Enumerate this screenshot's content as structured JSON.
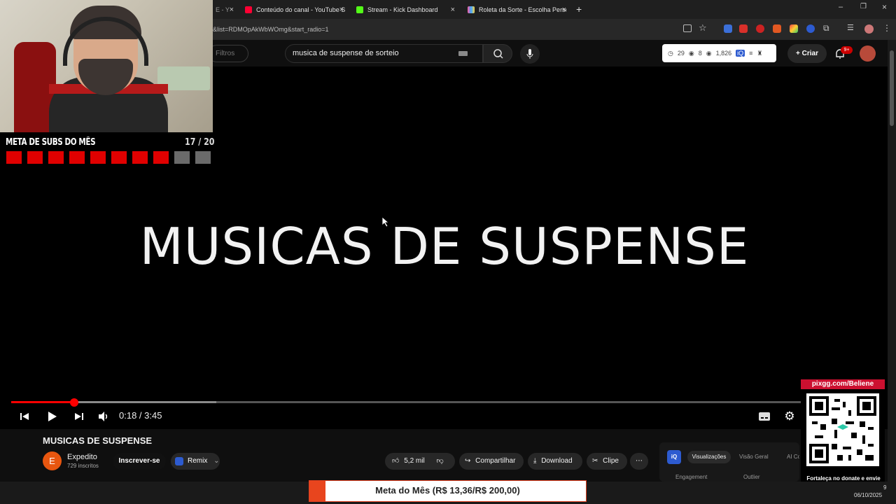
{
  "browser": {
    "tabs": [
      {
        "title": "Conteúdo do canal - YouTube S",
        "color": "#ff0033"
      },
      {
        "title": "Stream - Kick Dashboard",
        "color": "#53fc18"
      },
      {
        "title": "Roleta da Sorte - Escolha Perso",
        "color": "#ff5aa0"
      }
    ],
    "partial_tab_suffix": "E - Y",
    "url_fragment": "&list=RDMOpAkWbWOmg&start_radio=1",
    "new_tab_icon": "plus-icon"
  },
  "youtube": {
    "filters_label": "Filtros",
    "search_query": "musica de suspense de sorteio",
    "stats": {
      "likes": "29",
      "items": "8",
      "views": "1,826"
    },
    "create_label": "Criar",
    "notif_badge": "9+"
  },
  "video": {
    "overlay_title": "MUSICAS DE SUSPENSE",
    "time_current": "0:18",
    "time_total": "3:45",
    "time_display": "0:18 / 3:45",
    "progress_fraction": 0.08,
    "buffer_fraction": 0.26
  },
  "below_video": {
    "title": "MUSICAS DE SUSPENSE",
    "channel_initial": "E",
    "channel_name": "Expedito",
    "channel_subs": "729 inscritos",
    "subscribe_label": "Inscrever-se",
    "remix_label": "Remix",
    "likes_label": "5,2 mil",
    "share_label": "Compartilhar",
    "download_label": "Download",
    "clip_label": "Clipe",
    "panel_tabs": [
      "Visualizações",
      "Visão Geral",
      "AI Co"
    ],
    "panel_rows": [
      "Engagement",
      "Outlier"
    ]
  },
  "overlay": {
    "goal_title": "META DE SUBS DO MÊS",
    "goal_count": "17 / 20",
    "goal_filled": 8,
    "goal_total": 10,
    "goal_color": "#e00000",
    "pix_url": "pixgg.com/Beliene",
    "pix_message": "Fortaleça no donate e envie sua mensagem!",
    "meta_text": "Meta do Mês (R$ 13,36/R$ 200,00)",
    "meta_fraction": 0.067
  },
  "taskbar": {
    "date": "06/10/2025",
    "time_partial": "9"
  }
}
